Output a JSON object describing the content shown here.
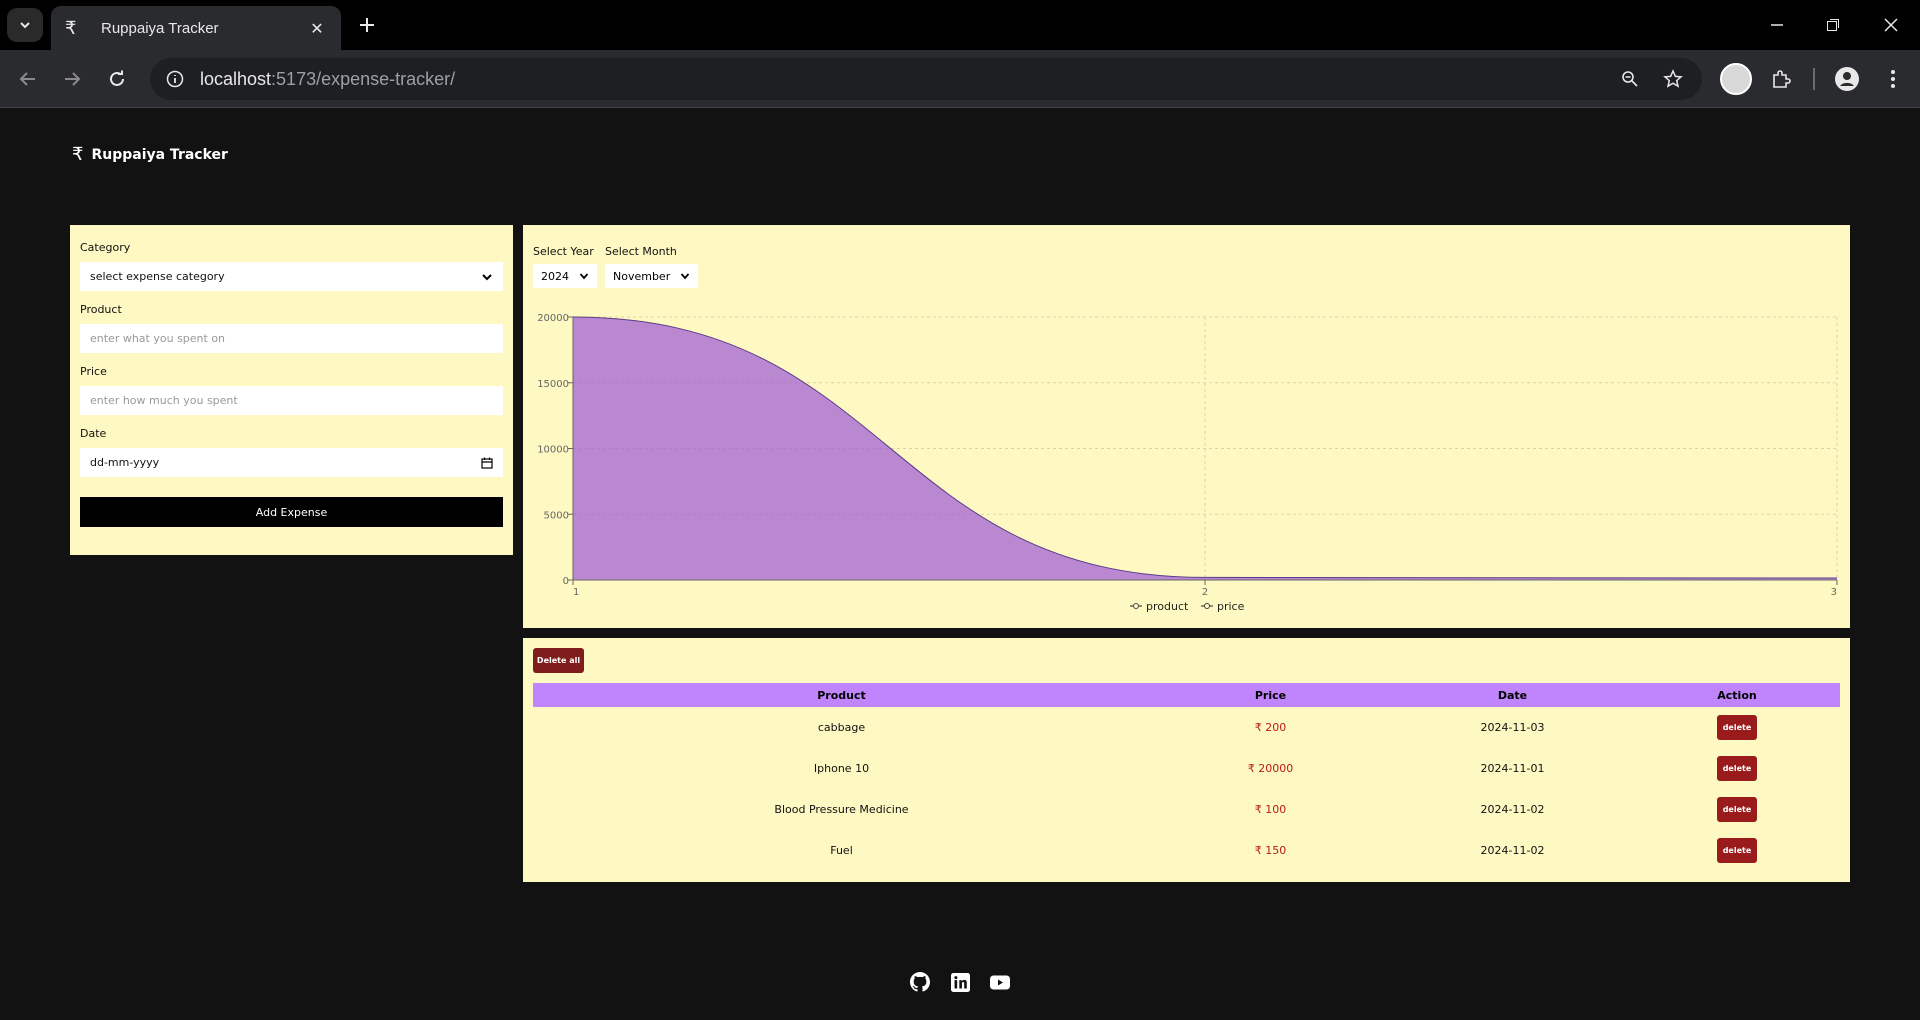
{
  "browser": {
    "tab_title": "Ruppaiya Tracker",
    "tab_favicon": "₹",
    "url_host": "localhost",
    "url_rest": ":5173/expense-tracker/"
  },
  "app": {
    "logo_symbol": "₹",
    "name": "Ruppaiya Tracker"
  },
  "form": {
    "category_label": "Category",
    "category_value": "select expense category",
    "product_label": "Product",
    "product_placeholder": "enter what you spent on",
    "price_label": "Price",
    "price_placeholder": "enter how much you spent",
    "date_label": "Date",
    "date_value": "dd-mm-yyyy",
    "submit_label": "Add Expense"
  },
  "filters": {
    "year_label": "Select Year",
    "year_value": "2024",
    "month_label": "Select Month",
    "month_value": "November"
  },
  "chart_data": {
    "type": "area",
    "x": [
      1,
      2,
      3
    ],
    "series": [
      {
        "name": "product",
        "values": [
          0,
          0,
          0
        ],
        "color": "#8884d8"
      },
      {
        "name": "price",
        "values": [
          20000,
          200,
          150
        ],
        "color": "#9b59d6"
      }
    ],
    "y_ticks": [
      0,
      5000,
      10000,
      15000,
      20000
    ],
    "x_ticks": [
      "1",
      "2",
      "3"
    ],
    "ylim": [
      0,
      20000
    ],
    "grid": true,
    "legend": "bottom-center"
  },
  "table": {
    "delete_all_label": "Delete all",
    "headers": [
      "Product",
      "Price",
      "Date",
      "Action"
    ],
    "rows": [
      {
        "product": "cabbage",
        "price": "₹ 200",
        "date": "2024-11-03",
        "action": "delete"
      },
      {
        "product": "Iphone 10",
        "price": "₹ 20000",
        "date": "2024-11-01",
        "action": "delete"
      },
      {
        "product": "Blood Pressure Medicine",
        "price": "₹ 100",
        "date": "2024-11-02",
        "action": "delete"
      },
      {
        "product": "Fuel",
        "price": "₹ 150",
        "date": "2024-11-02",
        "action": "delete"
      }
    ]
  },
  "footer": {
    "icons": [
      "github-icon",
      "linkedin-icon",
      "youtube-icon"
    ]
  }
}
